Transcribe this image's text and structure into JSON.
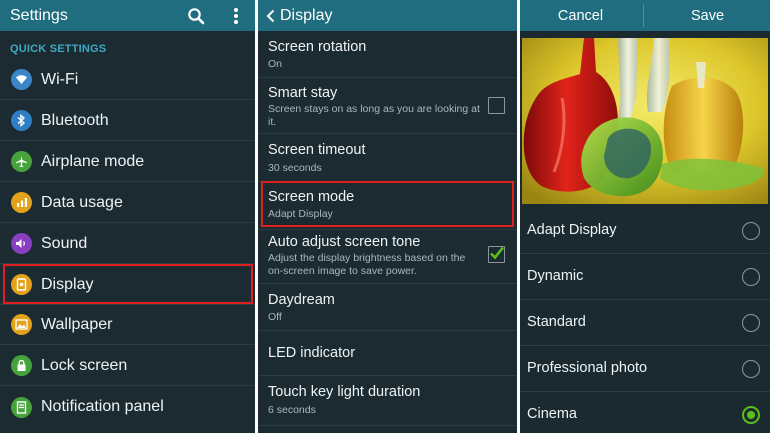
{
  "settings": {
    "title": "Settings",
    "section": "QUICK SETTINGS",
    "items": [
      {
        "label": "Wi-Fi",
        "icon": "wifi-icon",
        "color": "#3a86c8"
      },
      {
        "label": "Bluetooth",
        "icon": "bluetooth-icon",
        "color": "#2e7fc6"
      },
      {
        "label": "Airplane mode",
        "icon": "airplane-icon",
        "color": "#46a23a"
      },
      {
        "label": "Data usage",
        "icon": "data-usage-icon",
        "color": "#e3a21a"
      },
      {
        "label": "Sound",
        "icon": "sound-icon",
        "color": "#8a3fc0"
      },
      {
        "label": "Display",
        "icon": "display-icon",
        "color": "#e3a21a",
        "selected": true
      },
      {
        "label": "Wallpaper",
        "icon": "wallpaper-icon",
        "color": "#e3a21a"
      },
      {
        "label": "Lock screen",
        "icon": "lock-icon",
        "color": "#46a23a"
      },
      {
        "label": "Notification panel",
        "icon": "notification-icon",
        "color": "#46a23a"
      }
    ]
  },
  "display": {
    "title": "Display",
    "items": [
      {
        "title": "Screen rotation",
        "summary": "On"
      },
      {
        "title": "Smart stay",
        "summary": "Screen stays on as long as you are looking at it.",
        "checkbox": false
      },
      {
        "title": "Screen timeout",
        "summary": "30 seconds"
      },
      {
        "title": "Screen mode",
        "summary": "Adapt Display",
        "selected": true
      },
      {
        "title": "Auto adjust screen tone",
        "summary": "Adjust the display brightness based on the on-screen image to save power.",
        "checkbox": true
      },
      {
        "title": "Daydream",
        "summary": "Off"
      },
      {
        "title": "LED indicator",
        "summary": ""
      },
      {
        "title": "Touch key light duration",
        "summary": "6 seconds"
      }
    ]
  },
  "screen_mode": {
    "cancel": "Cancel",
    "save": "Save",
    "options": [
      {
        "label": "Adapt Display",
        "selected": false
      },
      {
        "label": "Dynamic",
        "selected": false
      },
      {
        "label": "Standard",
        "selected": false
      },
      {
        "label": "Professional photo",
        "selected": false
      },
      {
        "label": "Cinema",
        "selected": true
      }
    ]
  },
  "colors": {
    "actionbar": "#1f6d7e",
    "background": "#1b2b31",
    "highlight": "#e0201f",
    "accent_green": "#5ac018"
  }
}
